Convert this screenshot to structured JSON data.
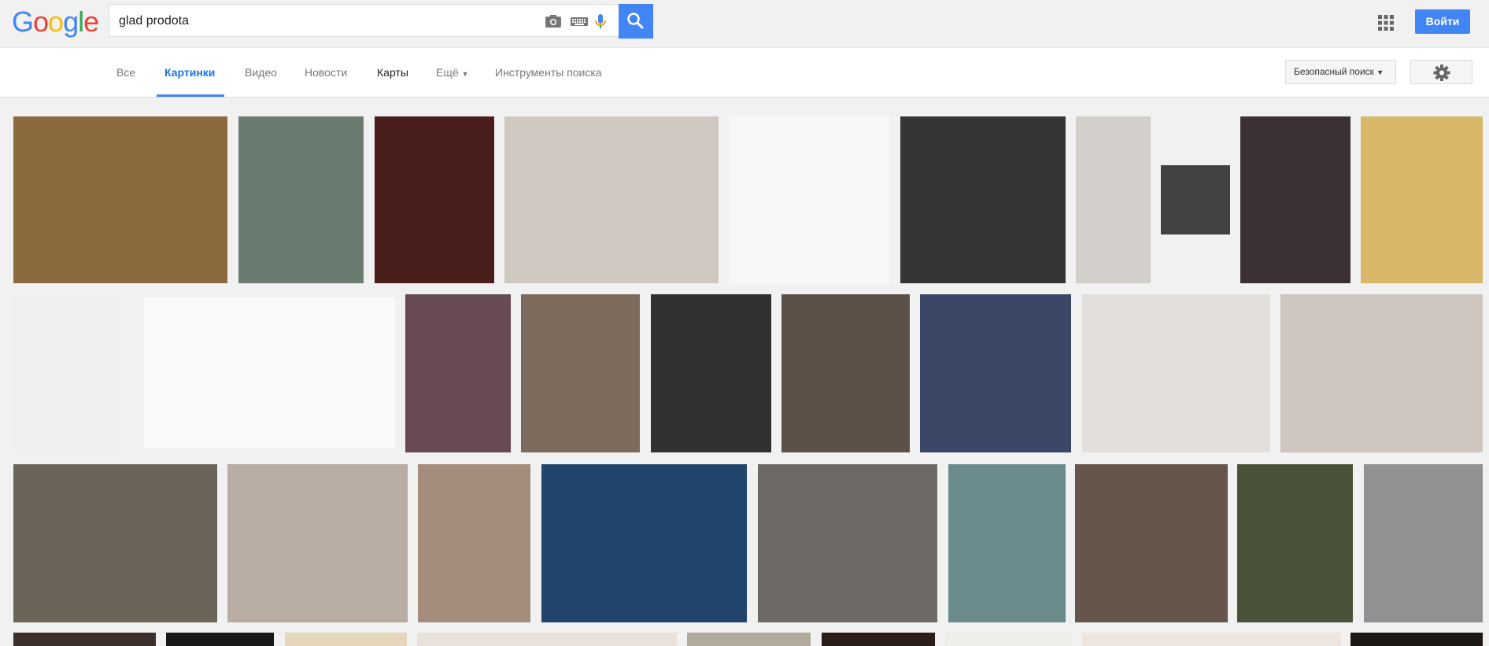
{
  "logo": "Google",
  "search": {
    "query": "glad prodota"
  },
  "signin": "Войти",
  "nav": {
    "all": "Все",
    "images": "Картинки",
    "video": "Видео",
    "news": "Новости",
    "maps": "Карты",
    "more": "Ещё",
    "tools": "Инструменты поиска"
  },
  "safe_search": "Безопасный поиск",
  "colors": {
    "accent": "#4285f4"
  },
  "thumbnails": [
    {
      "bg": "#8b6a3e"
    },
    {
      "bg": "#6a7c6f"
    },
    {
      "bg": "#4a1e1a"
    },
    {
      "bg": "#cfc8c0"
    },
    {
      "bg": "#f7f7f7"
    },
    {
      "bg": "#353535"
    },
    {
      "bg": "#d3d0cc"
    },
    {
      "bg": "#424242"
    },
    {
      "bg": "#3a3035"
    },
    {
      "bg": "#d8b769"
    },
    {
      "bg": "#f0f0f0"
    },
    {
      "bg": "#fafafa"
    },
    {
      "bg": "#684a52"
    },
    {
      "bg": "#7c6a5d"
    },
    {
      "bg": "#313131"
    },
    {
      "bg": "#5b5148"
    },
    {
      "bg": "#3a4766"
    },
    {
      "bg": "#e3dfdc"
    },
    {
      "bg": "#cfc7bf"
    },
    {
      "bg": "#6a6459"
    },
    {
      "bg": "#b8aca3"
    },
    {
      "bg": "#a58d7e"
    },
    {
      "bg": "#22466b"
    },
    {
      "bg": "#6d6a66"
    },
    {
      "bg": "#6a8a8b"
    },
    {
      "bg": "#66554a"
    },
    {
      "bg": "#495139"
    },
    {
      "bg": "#8f9192"
    },
    {
      "bg": "#3a2f2a"
    },
    {
      "bg": "#181818"
    },
    {
      "bg": "#e6d7bc"
    },
    {
      "bg": "#e8e2db"
    },
    {
      "bg": "#b2ab9c"
    },
    {
      "bg": "#2b1d19"
    },
    {
      "bg": "#f0eeea"
    },
    {
      "bg": "#efe5df"
    },
    {
      "bg": "#1d1714"
    }
  ]
}
